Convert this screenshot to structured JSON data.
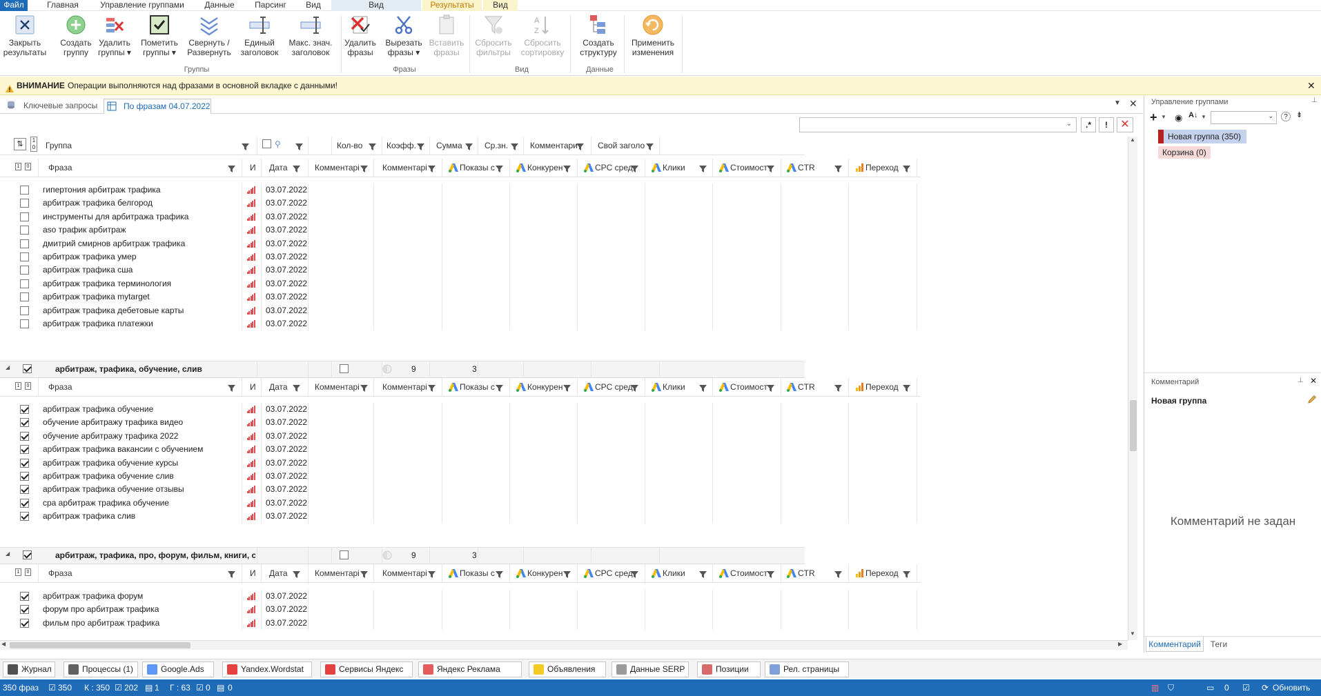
{
  "menu": {
    "tabs": [
      "Файл",
      "Главная",
      "Управление группами",
      "Данные",
      "Парсинг",
      "Вид",
      "Вид",
      "Результаты",
      "Вид"
    ]
  },
  "ribbon": {
    "buttons": [
      {
        "label1": "Закрыть",
        "label2": "результаты"
      },
      {
        "label1": "Создать",
        "label2": "группу"
      },
      {
        "label1": "Удалить",
        "label2": "группы ▾"
      },
      {
        "label1": "Пометить",
        "label2": "группы ▾"
      },
      {
        "label1": "Свернуть /",
        "label2": "Развернуть"
      },
      {
        "label1": "Единый",
        "label2": "заголовок"
      },
      {
        "label1": "Макс. знач.",
        "label2": "заголовок"
      },
      {
        "label1": "Удалить",
        "label2": "фразы"
      },
      {
        "label1": "Вырезать",
        "label2": "фразы ▾"
      },
      {
        "label1": "Вставить",
        "label2": "фразы"
      },
      {
        "label1": "Сбросить",
        "label2": "фильтры"
      },
      {
        "label1": "Сбросить",
        "label2": "сортировку"
      },
      {
        "label1": "Создать",
        "label2": "структуру"
      },
      {
        "label1": "Применить",
        "label2": "изменения"
      }
    ],
    "groups": [
      "Группы",
      "Фразы",
      "Вид",
      "Данные"
    ]
  },
  "warning": {
    "bold": "ВНИМАНИЕ",
    "text": " Операции выполняются над фразами в основной вкладке с данными!"
  },
  "doc_tabs": [
    "Ключевые запросы",
    "По фразам 04.07.2022"
  ],
  "group_header": {
    "cols": [
      "Группа",
      "Кол-во",
      "Коэфф.",
      "Сумма",
      "Ср.зн.",
      "Комментари",
      "Свой заголо"
    ]
  },
  "phrase_header": {
    "cols": [
      "Фраза",
      "И",
      "Дата",
      "Комментарі",
      "Комментарі",
      "Показы с",
      "Конкурен",
      "CPC сред",
      "Клики",
      "Стоимост",
      "CTR",
      "Переход"
    ]
  },
  "block1": {
    "rows": [
      {
        "phrase": "гипертония арбитраж трафика",
        "date": "03.07.2022",
        "checked": false
      },
      {
        "phrase": "арбитраж трафика белгород",
        "date": "03.07.2022",
        "checked": false
      },
      {
        "phrase": "инструменты для арбитража трафика",
        "date": "03.07.2022",
        "checked": false
      },
      {
        "phrase": "aso трафик арбитраж",
        "date": "03.07.2022",
        "checked": false
      },
      {
        "phrase": "дмитрий смирнов арбитраж трафика",
        "date": "03.07.2022",
        "checked": false
      },
      {
        "phrase": "арбитраж трафика умер",
        "date": "03.07.2022",
        "checked": false
      },
      {
        "phrase": "арбитраж трафика сша",
        "date": "03.07.2022",
        "checked": false
      },
      {
        "phrase": "арбитраж трафика терминология",
        "date": "03.07.2022",
        "checked": false
      },
      {
        "phrase": "арбитраж трафика mytarget",
        "date": "03.07.2022",
        "checked": false
      },
      {
        "phrase": "арбитраж трафика дебетовые карты",
        "date": "03.07.2022",
        "checked": false
      },
      {
        "phrase": "арбитраж трафика платежки",
        "date": "03.07.2022",
        "checked": false
      }
    ]
  },
  "group2": {
    "name": "арбитраж, трафика, обучение, слив",
    "count": "9",
    "coef": "3"
  },
  "block2": {
    "rows": [
      {
        "phrase": "арбитраж трафика обучение",
        "date": "03.07.2022",
        "checked": true
      },
      {
        "phrase": "обучение арбитражу трафика видео",
        "date": "03.07.2022",
        "checked": true
      },
      {
        "phrase": "обучение арбитражу трафика 2022",
        "date": "03.07.2022",
        "checked": true
      },
      {
        "phrase": "арбитраж трафика вакансии с обучением",
        "date": "03.07.2022",
        "checked": true
      },
      {
        "phrase": "арбитраж трафика обучение курсы",
        "date": "03.07.2022",
        "checked": true
      },
      {
        "phrase": "арбитраж трафика обучение слив",
        "date": "03.07.2022",
        "checked": true
      },
      {
        "phrase": "арбитраж трафика обучение отзывы",
        "date": "03.07.2022",
        "checked": true
      },
      {
        "phrase": "cpa арбитраж трафика обучение",
        "date": "03.07.2022",
        "checked": true
      },
      {
        "phrase": "арбитраж трафика слив",
        "date": "03.07.2022",
        "checked": true
      }
    ]
  },
  "group3": {
    "name": "арбитраж, трафика, про, форум, фильм, книги, сериал",
    "count": "9",
    "coef": "3"
  },
  "block3": {
    "rows": [
      {
        "phrase": "арбитраж трафика форум",
        "date": "03.07.2022",
        "checked": true
      },
      {
        "phrase": "форум про арбитраж трафика",
        "date": "03.07.2022",
        "checked": true
      },
      {
        "phrase": "фильм про арбитраж трафика",
        "date": "03.07.2022",
        "checked": true
      }
    ]
  },
  "right_panel": {
    "title": "Управление группами",
    "groups": [
      {
        "label": "Новая группа (350)"
      },
      {
        "label": "Корзина (0)"
      }
    ],
    "comment_title": "Комментарий",
    "comment_group": "Новая группа",
    "comment_empty": "Комментарий не задан",
    "tabs": [
      "Комментарий",
      "Теги"
    ]
  },
  "bottom_tabs": [
    "Журнал",
    "Процессы (1)",
    "Google.Ads",
    "Yandex.Wordstat",
    "Сервисы Яндекс",
    "Яндекс Реклама",
    "Объявления",
    "Данные SERP",
    "Позиции",
    "Рел. страницы"
  ],
  "status": {
    "phrases": "350 фраз",
    "checked": "350",
    "k": "К : 350",
    "v202": "202",
    "v1": "1",
    "g": "Г : 63",
    "v0a": "0",
    "v0b": "0",
    "right0": "0",
    "refresh": "Обновить"
  },
  "colors": {
    "accent": "#1e6bb8",
    "warning_bg": "#fdf6d3",
    "selected_group": "#c5d2ee",
    "trash": "#f6dada"
  }
}
